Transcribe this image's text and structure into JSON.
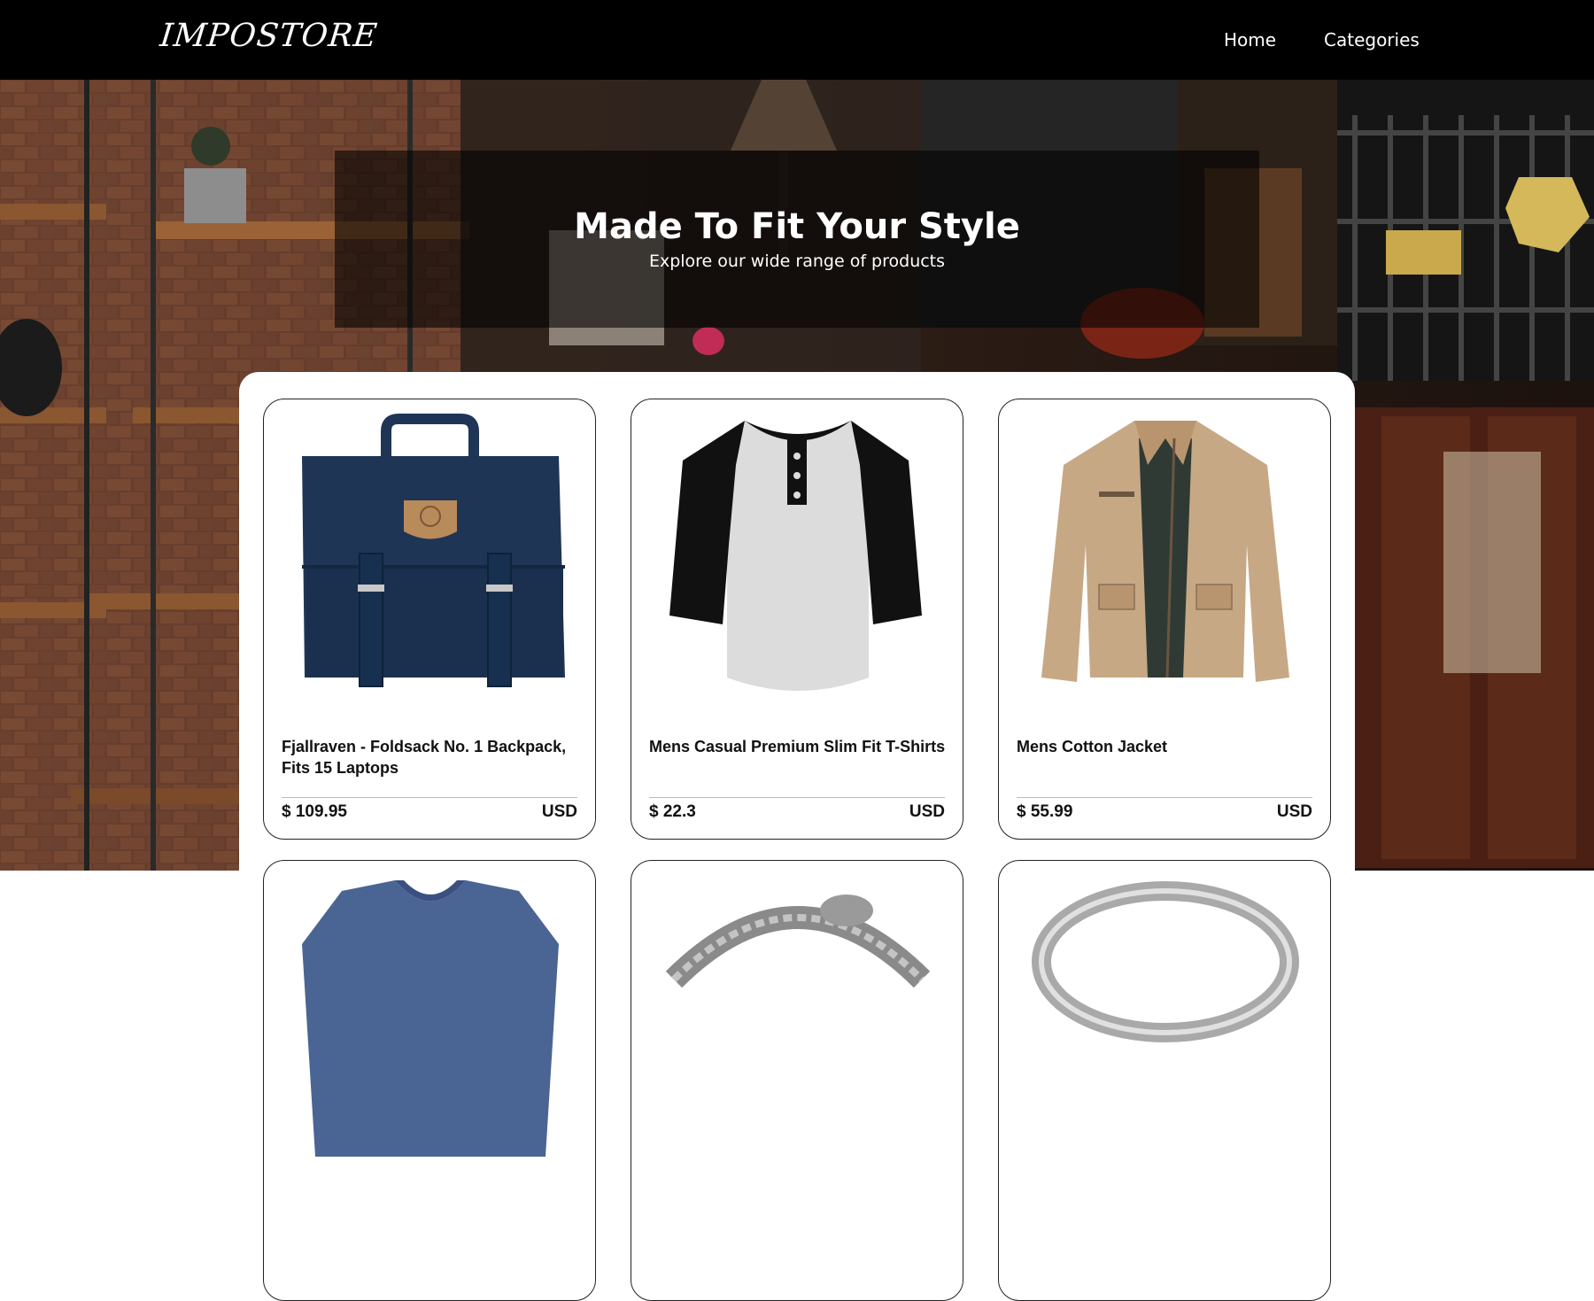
{
  "navbar": {
    "logo": "IMPOSTORE",
    "links": [
      {
        "label": "Home"
      },
      {
        "label": "Categories"
      }
    ]
  },
  "hero": {
    "title": "Made To Fit Your Style",
    "subtitle": "Explore our wide range of products"
  },
  "products": [
    {
      "title": "Fjallraven - Foldsack No. 1 Backpack, Fits 15 Laptops",
      "price": "$ 109.95",
      "currency": "USD",
      "icon": "backpack-icon"
    },
    {
      "title": "Mens Casual Premium Slim Fit T-Shirts",
      "price": "$ 22.3",
      "currency": "USD",
      "icon": "tshirt-icon"
    },
    {
      "title": "Mens Cotton Jacket",
      "price": "$ 55.99",
      "currency": "USD",
      "icon": "jacket-icon"
    }
  ],
  "colors": {
    "navbar_bg": "#000000",
    "hero_overlay": "rgba(0,0,0,0.58)",
    "backpack": "#1f3556",
    "tshirt_body": "#dcdcdc",
    "tshirt_sleeve": "#111111",
    "jacket": "#c7a885",
    "tee_blue": "#4a6494"
  }
}
